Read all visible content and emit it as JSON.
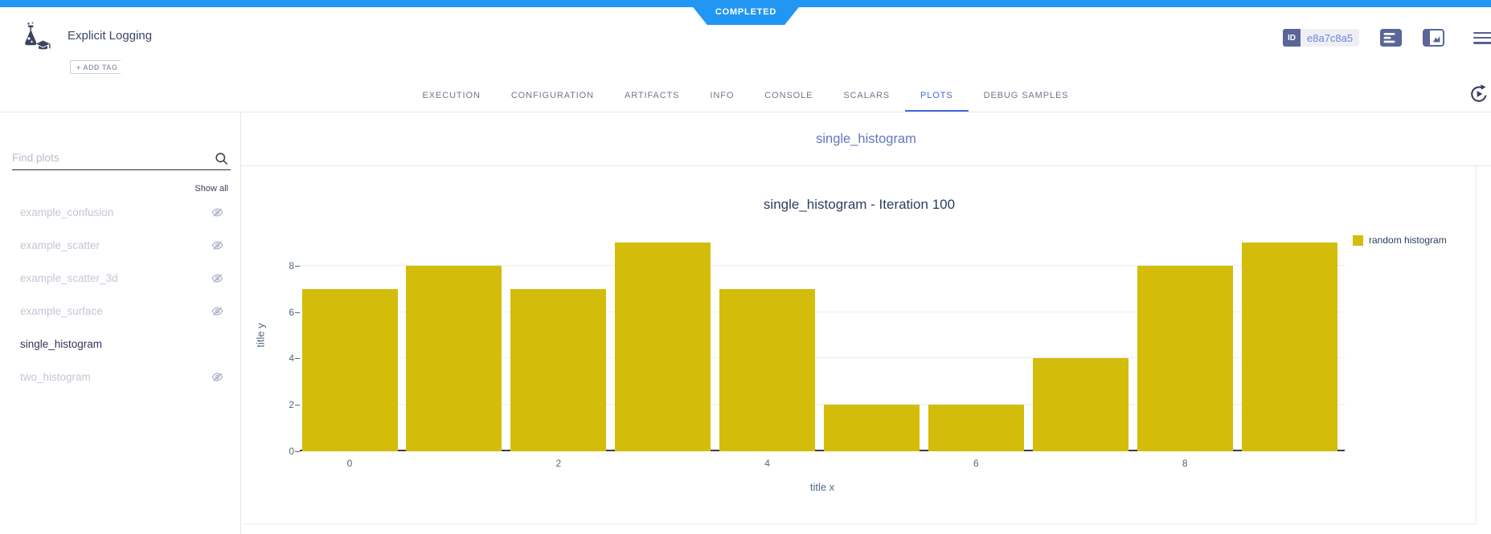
{
  "status_banner": {
    "label": "COMPLETED"
  },
  "header": {
    "title": "Explicit Logging",
    "add_tag_label": "+ ADD TAG",
    "id_badge_label": "ID",
    "id_value": "e8a7c8a5",
    "icons": [
      "experiment-icon",
      "details-icon",
      "side-panel-icon",
      "menu-icon"
    ]
  },
  "tabs": {
    "items": [
      "EXECUTION",
      "CONFIGURATION",
      "ARTIFACTS",
      "INFO",
      "CONSOLE",
      "SCALARS",
      "PLOTS",
      "DEBUG SAMPLES"
    ],
    "active": "PLOTS",
    "refresh_icon": "auto-refresh-icon"
  },
  "sidebar": {
    "search_placeholder": "Find plots",
    "search_icon": "search-icon",
    "show_all_label": "Show all",
    "items": [
      {
        "label": "example_confusion",
        "hidden": true,
        "active": false
      },
      {
        "label": "example_scatter",
        "hidden": true,
        "active": false
      },
      {
        "label": "example_scatter_3d",
        "hidden": true,
        "active": false
      },
      {
        "label": "example_surface",
        "hidden": true,
        "active": false
      },
      {
        "label": "single_histogram",
        "hidden": false,
        "active": true
      },
      {
        "label": "two_histogram",
        "hidden": true,
        "active": false
      }
    ]
  },
  "main": {
    "section_title": "single_histogram"
  },
  "chart_data": {
    "type": "bar",
    "title": "single_histogram - Iteration 100",
    "xlabel": "title x",
    "ylabel": "title y",
    "x": [
      0,
      1,
      2,
      3,
      4,
      5,
      6,
      7,
      8,
      9
    ],
    "series": [
      {
        "name": "random histogram",
        "color": "#d4bc0a",
        "values": [
          7,
          8,
          7,
          9,
          7,
          2,
          2,
          4,
          8,
          9
        ]
      }
    ],
    "xticks": [
      0,
      2,
      4,
      6,
      8
    ],
    "yticks": [
      0,
      2,
      4,
      6,
      8
    ],
    "ylim": [
      0,
      10
    ],
    "grid": true,
    "legend_position": "top-right"
  },
  "colors": {
    "accent_blue": "#2196f3",
    "active_tab_blue": "#4a65dd",
    "bar_yellow": "#d4bc0a",
    "slate_icon": "#5a6598",
    "id_value_blue": "#7282d6"
  }
}
